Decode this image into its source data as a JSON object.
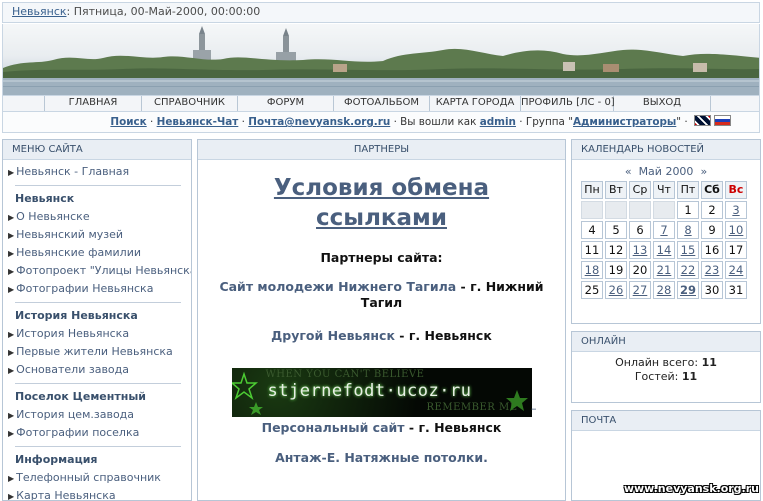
{
  "topbar": {
    "site_link": "Невьянск",
    "date_text": ": Пятница, 00-Май-2000, 00:00:00"
  },
  "nav": [
    "ГЛАВНАЯ",
    "СПРАВОЧНИК",
    "ФОРУМ",
    "ФОТОАЛЬБОМ",
    "КАРТА ГОРОДА",
    "ПРОФИЛЬ [ЛС - 0]",
    "ВЫХОД"
  ],
  "userbar": {
    "search": "Поиск",
    "sep1": " · ",
    "chat": "Невьянск-Чат",
    "sep2": " · ",
    "mail": "Почта@nevyansk.org.ru",
    "logged_prefix": " · Вы вошли как ",
    "user": "admin",
    "group_prefix": " · Группа \"",
    "group": "Администраторы",
    "group_suffix": "\" · "
  },
  "left_menu": {
    "header": "МЕНЮ САЙТА",
    "home": "Невьянск - Главная",
    "section1": {
      "title": "Невьянск",
      "items": [
        "О Невьянске",
        "Невьянский музей",
        "Невьянские фамилии",
        "Фотопроект \"Улицы Невьянска\"",
        "Фотографии Невьянска"
      ]
    },
    "section2": {
      "title": "История Невьянска",
      "items": [
        "История Невьянска",
        "Первые жители Невьянска",
        "Основатели завода"
      ]
    },
    "section3": {
      "title": "Поселок Цементный",
      "items": [
        "История цем.завода",
        "Фотографии поселка"
      ]
    },
    "section4": {
      "title": "Информация",
      "items": [
        "Телефонный справочник",
        "Карта Невьянска"
      ]
    }
  },
  "center": {
    "header": "ПАРТНЕРЫ",
    "title_line1": "Условия обмена",
    "title_line2": "ссылками",
    "subtitle": "Партнеры сайта:",
    "partners": [
      {
        "name": "Сайт молодежи Нижнего Тагила",
        "sep": " - ",
        "city": "г. Нижний Тагил"
      },
      {
        "name": "Другой Невьянск",
        "sep": " - ",
        "city": "г. Невьянск"
      },
      {
        "name": "Персональный сайт",
        "sep": " - ",
        "city": "г. Невьянск"
      },
      {
        "name": "Антаж-Е. Натяжные потолки.",
        "sep": "",
        "city": ""
      }
    ],
    "banner": {
      "line1": "WHEN YOU CAN'T BELIEVE",
      "url": "stjernefodt·ucoz·ru",
      "line2": "REMEMBER ME"
    },
    "dash": "–"
  },
  "calendar": {
    "header": "КАЛЕНДАРЬ НОВОСТЕЙ",
    "prev": "«",
    "month": "Май 2000",
    "next": "»",
    "weekdays": [
      "Пн",
      "Вт",
      "Ср",
      "Чт",
      "Пт",
      "Сб",
      "Вс"
    ],
    "weeks": [
      [
        "",
        "",
        "",
        "",
        "1",
        "2",
        "3"
      ],
      [
        "4",
        "5",
        "6",
        "7",
        "8",
        "9",
        "10"
      ],
      [
        "11",
        "12",
        "13",
        "14",
        "15",
        "16",
        "17"
      ],
      [
        "18",
        "19",
        "20",
        "21",
        "22",
        "23",
        "24"
      ],
      [
        "25",
        "26",
        "27",
        "28",
        "29",
        "30",
        "31"
      ]
    ],
    "linked_days": [
      "3",
      "7",
      "8",
      "10",
      "13",
      "14",
      "15",
      "18",
      "21",
      "22",
      "23",
      "24",
      "26",
      "27",
      "28",
      "29"
    ],
    "bold_days": [
      "29"
    ]
  },
  "online": {
    "header": "ОНЛАЙН",
    "total_label": "Онлайн всего: ",
    "total": "11",
    "guests_label": "Гостей: ",
    "guests": "11"
  },
  "mail_panel": {
    "header": "ПОЧТА"
  },
  "watermark": "www.nevyansk.org.ru",
  "colors": {
    "link": "#4a5f7e",
    "border": "#b7c6d6",
    "panel_head": "#e9eef4",
    "sunday": "#cc0000"
  }
}
